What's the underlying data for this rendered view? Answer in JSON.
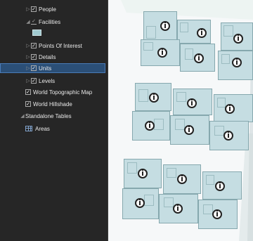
{
  "layers": {
    "people": "People",
    "facilities": "Facilities",
    "points_of_interest": "Points Of Interest",
    "details": "Details",
    "units": "Units",
    "levels": "Levels",
    "world_topographic_map": "World Topographic Map",
    "world_hillshade": "World Hillshade",
    "standalone_tables": "Standalone Tables",
    "areas": "Areas"
  },
  "colors": {
    "panel_bg": "#262626",
    "selected_bg": "#2b4f77",
    "unit_fill": "#c5dde2",
    "map_bg": "#f3f6f7"
  },
  "icons": {
    "poi": "info-circle-icon",
    "table": "table-icon"
  }
}
